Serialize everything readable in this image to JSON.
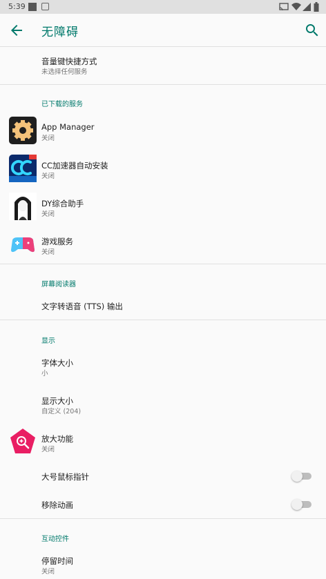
{
  "status_bar": {
    "time": "5:39"
  },
  "app_bar": {
    "title": "无障碍",
    "back_icon": "arrow-back-icon",
    "search_icon": "search-icon"
  },
  "shortcut": {
    "title": "音量键快捷方式",
    "subtitle": "未选择任何服务"
  },
  "downloaded": {
    "header": "已下载的服务",
    "items": [
      {
        "title": "App Manager",
        "subtitle": "关闭",
        "icon": "gear-icon"
      },
      {
        "title": "CC加速器自动安装",
        "subtitle": "关闭",
        "icon": "cc-logo-icon"
      },
      {
        "title": "DY综合助手",
        "subtitle": "关闭",
        "icon": "anime-avatar-icon"
      },
      {
        "title": "游戏服务",
        "subtitle": "关闭",
        "icon": "gamepad-icon"
      }
    ]
  },
  "screen_reader": {
    "header": "屏幕阅读器",
    "tts": "文字转语音 (TTS) 输出"
  },
  "display": {
    "header": "显示",
    "font_size": {
      "title": "字体大小",
      "subtitle": "小"
    },
    "display_size": {
      "title": "显示大小",
      "subtitle": "自定义 (204)"
    },
    "magnification": {
      "title": "放大功能",
      "subtitle": "关闭",
      "icon": "magnify-icon"
    },
    "large_pointer": {
      "title": "大号鼠标指针",
      "enabled": false
    },
    "remove_animations": {
      "title": "移除动画",
      "enabled": false
    }
  },
  "interaction": {
    "header": "互动控件",
    "dwell": {
      "title": "停留时间",
      "subtitle": "关闭"
    }
  },
  "colors": {
    "accent": "#00796b",
    "divider": "#e0e0e0",
    "status_bar": "#e0e0e0"
  }
}
